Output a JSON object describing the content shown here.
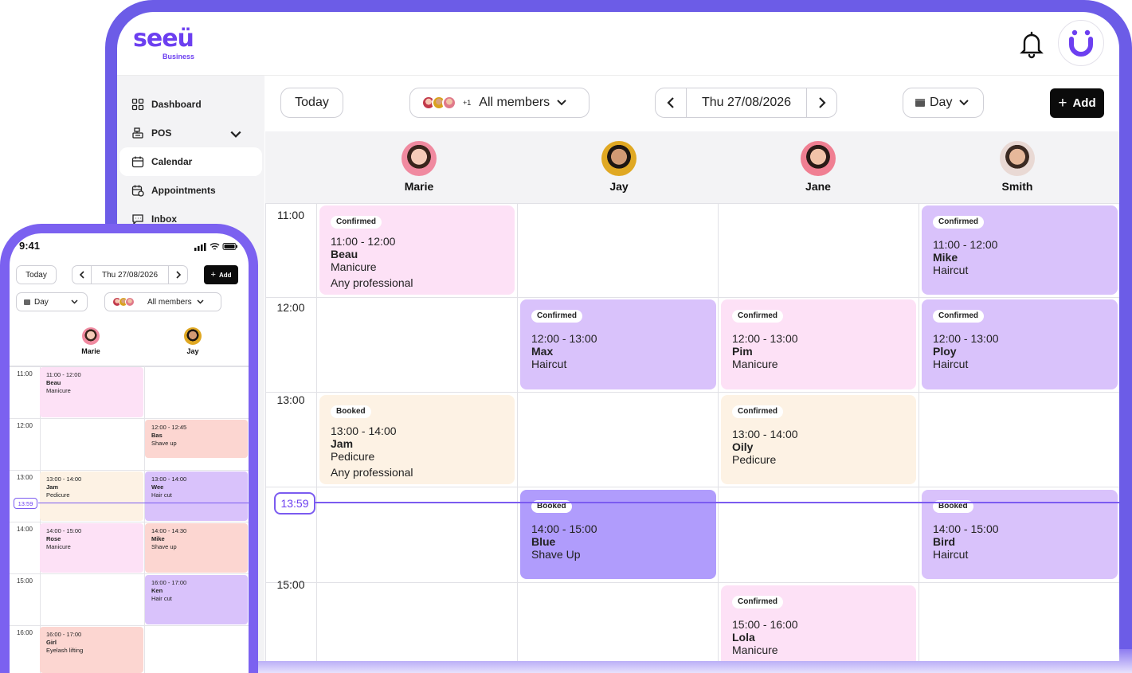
{
  "brand": {
    "name": "seeü",
    "sub": "Business"
  },
  "sidebar": {
    "items": [
      {
        "label": "Dashboard",
        "icon": "grid-icon"
      },
      {
        "label": "POS",
        "icon": "register-icon"
      },
      {
        "label": "Calendar",
        "icon": "calendar-icon",
        "active": true
      },
      {
        "label": "Appointments",
        "icon": "calendar-clock-icon"
      },
      {
        "label": "Inbox",
        "icon": "chat-icon"
      }
    ]
  },
  "toolbar": {
    "today": "Today",
    "members_count": "+1",
    "members": "All members",
    "date": "Thu 27/08/2026",
    "view": "Day",
    "add": "Add"
  },
  "staff": [
    "Marie",
    "Jay",
    "Jane",
    "Smith"
  ],
  "times": [
    "11:00",
    "12:00",
    "13:00",
    "15:00"
  ],
  "now": "13:59",
  "events": [
    {
      "status": "Confirmed",
      "time": "11:00 - 12:00",
      "name": "Beau",
      "service": "Manicure",
      "extra": "Any professional"
    },
    {
      "status": "Confirmed",
      "time": "11:00 - 12:00",
      "name": "Mike",
      "service": "Haircut"
    },
    {
      "status": "Confirmed",
      "time": "12:00 - 13:00",
      "name": "Max",
      "service": "Haircut"
    },
    {
      "status": "Confirmed",
      "time": "12:00 - 13:00",
      "name": "Pim",
      "service": "Manicure"
    },
    {
      "status": "Confirmed",
      "time": "12:00 - 13:00",
      "name": "Ploy",
      "service": "Haircut"
    },
    {
      "status": "Booked",
      "time": "13:00 - 14:00",
      "name": "Jam",
      "service": "Pedicure",
      "extra": "Any professional"
    },
    {
      "status": "Confirmed",
      "time": "13:00 - 14:00",
      "name": "Oily",
      "service": "Pedicure"
    },
    {
      "status": "Booked",
      "time": "14:00 - 15:00",
      "name": "Blue",
      "service": "Shave Up"
    },
    {
      "status": "Booked",
      "time": "14:00 - 15:00",
      "name": "Bird",
      "service": "Haircut"
    },
    {
      "status": "Confirmed",
      "time": "15:00 - 16:00",
      "name": "Lola",
      "service": "Manicure"
    }
  ],
  "phone": {
    "status_time": "9:41",
    "today": "Today",
    "date": "Thu 27/08/2026",
    "add": "Add",
    "view": "Day",
    "members": "All members",
    "staff": [
      "Marie",
      "Jay"
    ],
    "times": [
      "11:00",
      "12:00",
      "13:00",
      "14:00",
      "15:00",
      "16:00"
    ],
    "now": "13:59",
    "events": [
      {
        "time": "11:00 - 12:00",
        "name": "Beau",
        "service": "Manicure"
      },
      {
        "time": "12:00 - 12:45",
        "name": "Bas",
        "service": "Shave up"
      },
      {
        "time": "13:00 - 14:00",
        "name": "Jam",
        "service": "Pedicure"
      },
      {
        "time": "13:00 - 14:00",
        "name": "Wee",
        "service": "Hair cut"
      },
      {
        "time": "14:00 - 15:00",
        "name": "Rose",
        "service": "Manicure"
      },
      {
        "time": "14:00 - 14:30",
        "name": "Mike",
        "service": "Shave up"
      },
      {
        "time": "16:00 - 17:00",
        "name": "Ken",
        "service": "Hair cut"
      },
      {
        "time": "16:00 - 17:00",
        "name": "Girl",
        "service": "Eyelash lifting"
      }
    ]
  },
  "colors": {
    "accent": "#6c3ff0",
    "frame": "#6c5ce7",
    "pink": "#fde1f6",
    "lavender": "#d9c2fb",
    "cream": "#fdf2e4",
    "purple": "#b09cfc",
    "salmon": "#fcd6d1"
  }
}
